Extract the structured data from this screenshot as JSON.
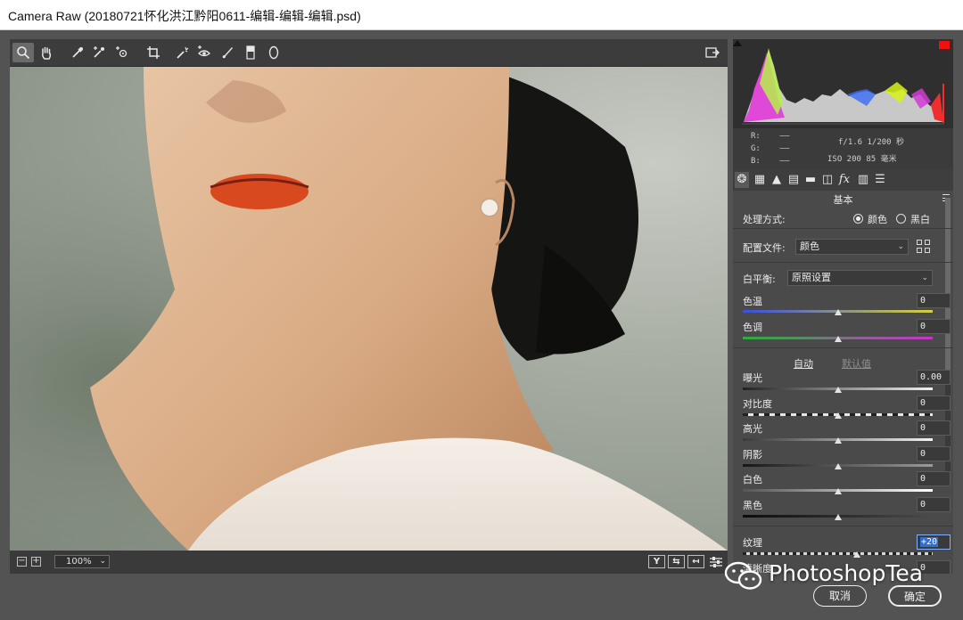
{
  "window": {
    "title": "Camera Raw (20180721怀化洪江黔阳0611-编辑-编辑-编辑.psd)"
  },
  "toolbar": {
    "tools": [
      "zoom-tool-icon",
      "hand-tool-icon",
      "white-balance-tool-icon",
      "color-sampler-icon",
      "targeted-adjustment-icon",
      "crop-tool-icon",
      "spot-removal-icon",
      "red-eye-icon",
      "adjustment-brush-icon",
      "graduated-filter-icon",
      "radial-filter-icon"
    ],
    "export_icon": "open-preferences-icon"
  },
  "histogram": {
    "rgb": [
      {
        "label": "R:",
        "value": "——"
      },
      {
        "label": "G:",
        "value": "——"
      },
      {
        "label": "B:",
        "value": "——"
      }
    ],
    "aperture_shutter": "f/1.6  1/200 秒",
    "iso_focal": "ISO 200  85 毫米",
    "clip_color": "#f01010"
  },
  "panel_tabs": [
    "basic-icon",
    "tone-curve-icon",
    "detail-icon",
    "hsl-icon",
    "split-toning-icon",
    "lens-corrections-icon",
    "effects-icon",
    "camera-calibration-icon",
    "presets-icon"
  ],
  "basic": {
    "title": "基本",
    "treatment_label": "处理方式:",
    "treatment_color": "颜色",
    "treatment_bw": "黑白",
    "profile_label": "配置文件:",
    "profile_value": "颜色",
    "wb_label": "白平衡:",
    "wb_value": "原照设置",
    "auto": "自动",
    "default": "默认值",
    "sliders": [
      {
        "label": "色温",
        "value": "0",
        "position": 0.5
      },
      {
        "label": "色调",
        "value": "0",
        "position": 0.5
      },
      {
        "label": "曝光",
        "value": "0.00",
        "position": 0.5
      },
      {
        "label": "对比度",
        "value": "0",
        "position": 0.5
      },
      {
        "label": "高光",
        "value": "0",
        "position": 0.5
      },
      {
        "label": "阴影",
        "value": "0",
        "position": 0.5
      },
      {
        "label": "白色",
        "value": "0",
        "position": 0.5
      },
      {
        "label": "黑色",
        "value": "0",
        "position": 0.5
      },
      {
        "label": "纹理",
        "value": "+20",
        "position": 0.6
      },
      {
        "label": "清晰度",
        "value": "0",
        "position": 0.5
      }
    ]
  },
  "footer": {
    "zoom_value": "100%",
    "view_buttons": [
      "Y",
      "⇆",
      "↤"
    ],
    "cancel": "取消",
    "ok": "确定"
  },
  "watermark": "PhotoshopTea"
}
